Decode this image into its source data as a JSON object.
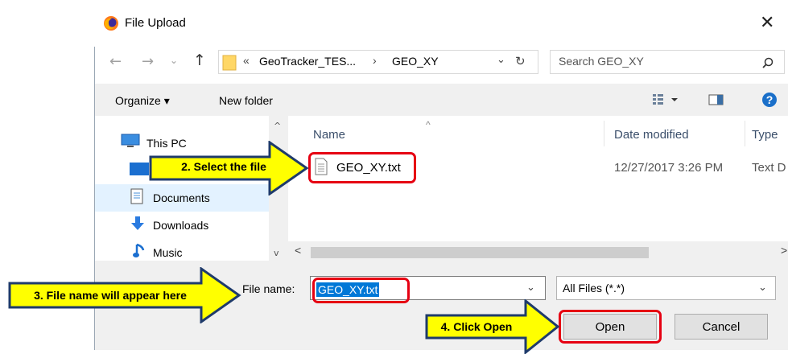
{
  "window": {
    "title": "File Upload",
    "close_glyph": "✕",
    "icon": "firefox-icon"
  },
  "address_bar": {
    "overflow_glyph": "«",
    "segments": [
      "GeoTracker_TES...",
      "GEO_XY"
    ],
    "separator": "›",
    "search_placeholder": "Search GEO_XY"
  },
  "toolbar": {
    "organize_label": "Organize ▾",
    "new_folder_label": "New folder"
  },
  "nav_pane": {
    "items": [
      {
        "label": "This PC",
        "icon": "computer-icon"
      },
      {
        "label": "",
        "icon": "desktop-icon"
      },
      {
        "label": "Documents",
        "icon": "documents-icon"
      },
      {
        "label": "Downloads",
        "icon": "downloads-icon"
      },
      {
        "label": "Music",
        "icon": "music-icon"
      }
    ]
  },
  "file_list": {
    "columns": [
      "Name",
      "Date modified",
      "Type"
    ],
    "rows": [
      {
        "name": "GEO_XY.txt",
        "date": "12/27/2017 3:26 PM",
        "type": "Text D"
      }
    ]
  },
  "bottom": {
    "file_name_label": "File name:",
    "file_name_value": "GEO_XY.txt",
    "filter_value": "All Files (*.*)",
    "open_label": "Open",
    "cancel_label": "Cancel"
  },
  "callouts": {
    "select_file": "2. Select the file",
    "file_name_appear": "3. File name will appear here",
    "click_open": "4. Click Open"
  },
  "colors": {
    "callout_fill": "#ffff00",
    "callout_border": "#1f3b6b",
    "highlight_box": "#e60012",
    "selection_blue": "#0078d7"
  }
}
